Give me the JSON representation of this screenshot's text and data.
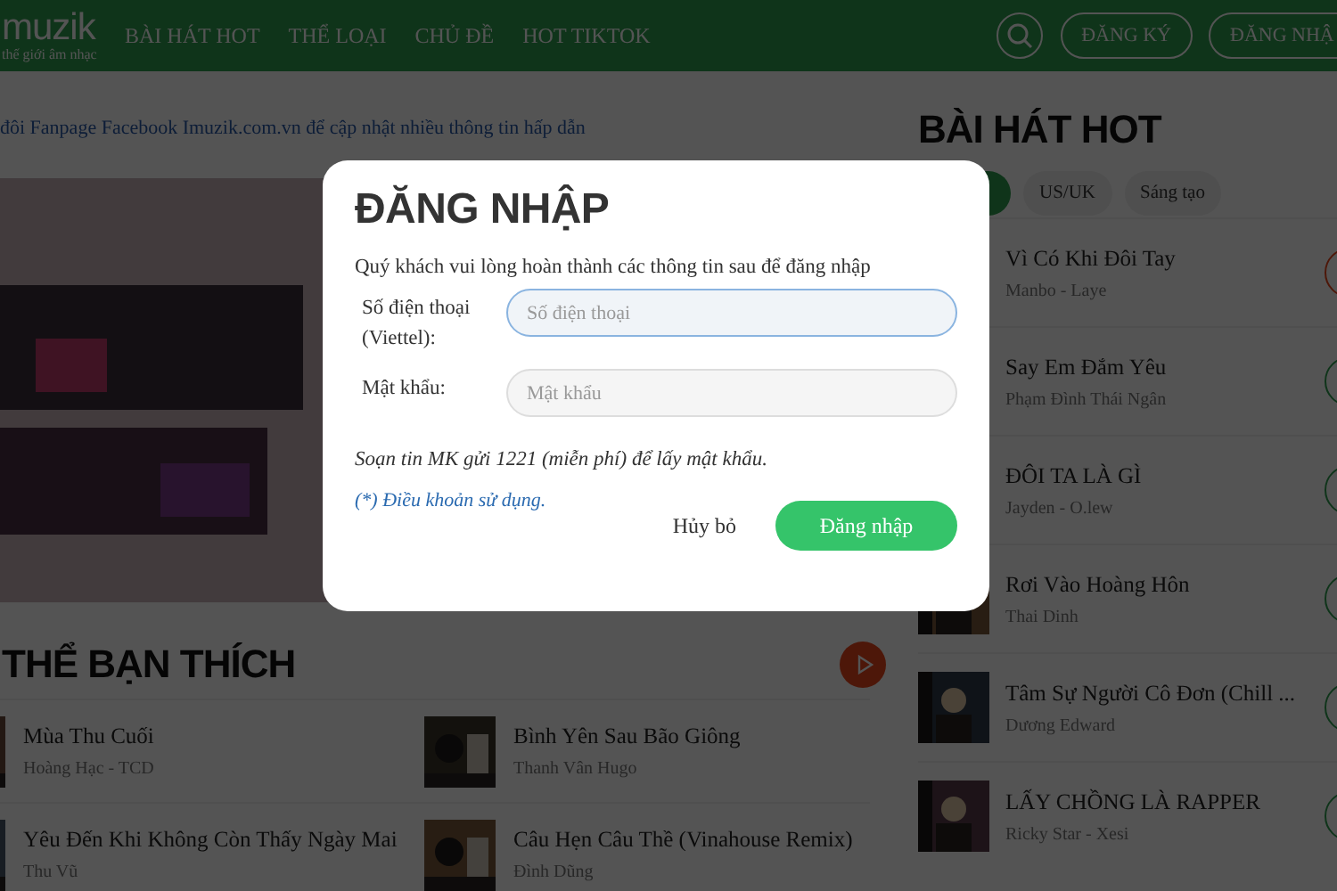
{
  "header": {
    "logo": "muzik",
    "tagline": "thế giới âm nhạc",
    "nav": [
      {
        "label": "BÀI HÁT HOT"
      },
      {
        "label": "THỂ LOẠI"
      },
      {
        "label": "CHỦ ĐỀ"
      },
      {
        "label": "HOT TIKTOK"
      }
    ],
    "register": "ĐĂNG KÝ",
    "login": "ĐĂNG NHẬ"
  },
  "notice": "đôi Fanpage Facebook Imuzik.com.vn để cập nhật nhiều thông tin hấp dẫn",
  "suggest": {
    "title": "THỂ BẠN THÍCH",
    "songs": [
      {
        "title": "Mùa Thu Cuối",
        "artist": "Hoàng Hạc - TCD"
      },
      {
        "title": "Bình Yên Sau Bão Giông",
        "artist": "Thanh Vân Hugo"
      },
      {
        "title": "Yêu Đến Khi Không Còn Thấy Ngày Mai",
        "artist": "Thu Vũ"
      },
      {
        "title": "Câu Hẹn Câu Thề (Vinahouse Remix)",
        "artist": "Đình Dũng"
      }
    ]
  },
  "hot": {
    "title": "BÀI HÁT HOT",
    "chips": [
      {
        "selected": true
      },
      {
        "label": "US/UK",
        "selected": false
      },
      {
        "label": "Sáng tạo",
        "selected": false
      }
    ],
    "songs": [
      {
        "title": "Vì Có Khi Đôi Tay",
        "artist": "Manbo - Laye"
      },
      {
        "title": "Say Em Đắm Yêu",
        "artist": "Phạm Đình Thái Ngân"
      },
      {
        "title": "ĐÔI TA LÀ GÌ",
        "artist": "Jayden - O.lew"
      },
      {
        "title": "Rơi Vào Hoàng Hôn",
        "artist": "Thai Dinh"
      },
      {
        "title": "Tâm Sự Người Cô Đơn (Chill ...",
        "artist": "Dương Edward"
      },
      {
        "title": "LẤY CHỒNG LÀ RAPPER",
        "artist": "Ricky Star - Xesi"
      }
    ]
  },
  "dialog": {
    "title": "ĐĂNG NHẬP",
    "intro": "Quý khách vui lòng hoàn thành các thông tin sau để đăng nhập",
    "fields": [
      {
        "label": "Số điện thoại (Viettel):",
        "placeholder": "Số điện thoại",
        "focused": true
      },
      {
        "label": "Mật khẩu:",
        "placeholder": "Mật khẩu",
        "focused": false
      }
    ],
    "note": "Soạn tin MK gửi 1221 (miễn phí) để lấy mật khẩu.",
    "terms": "(*) Điều khoản sử dụng.",
    "cancel": "Hủy bỏ",
    "submit": "Đăng nhập"
  }
}
